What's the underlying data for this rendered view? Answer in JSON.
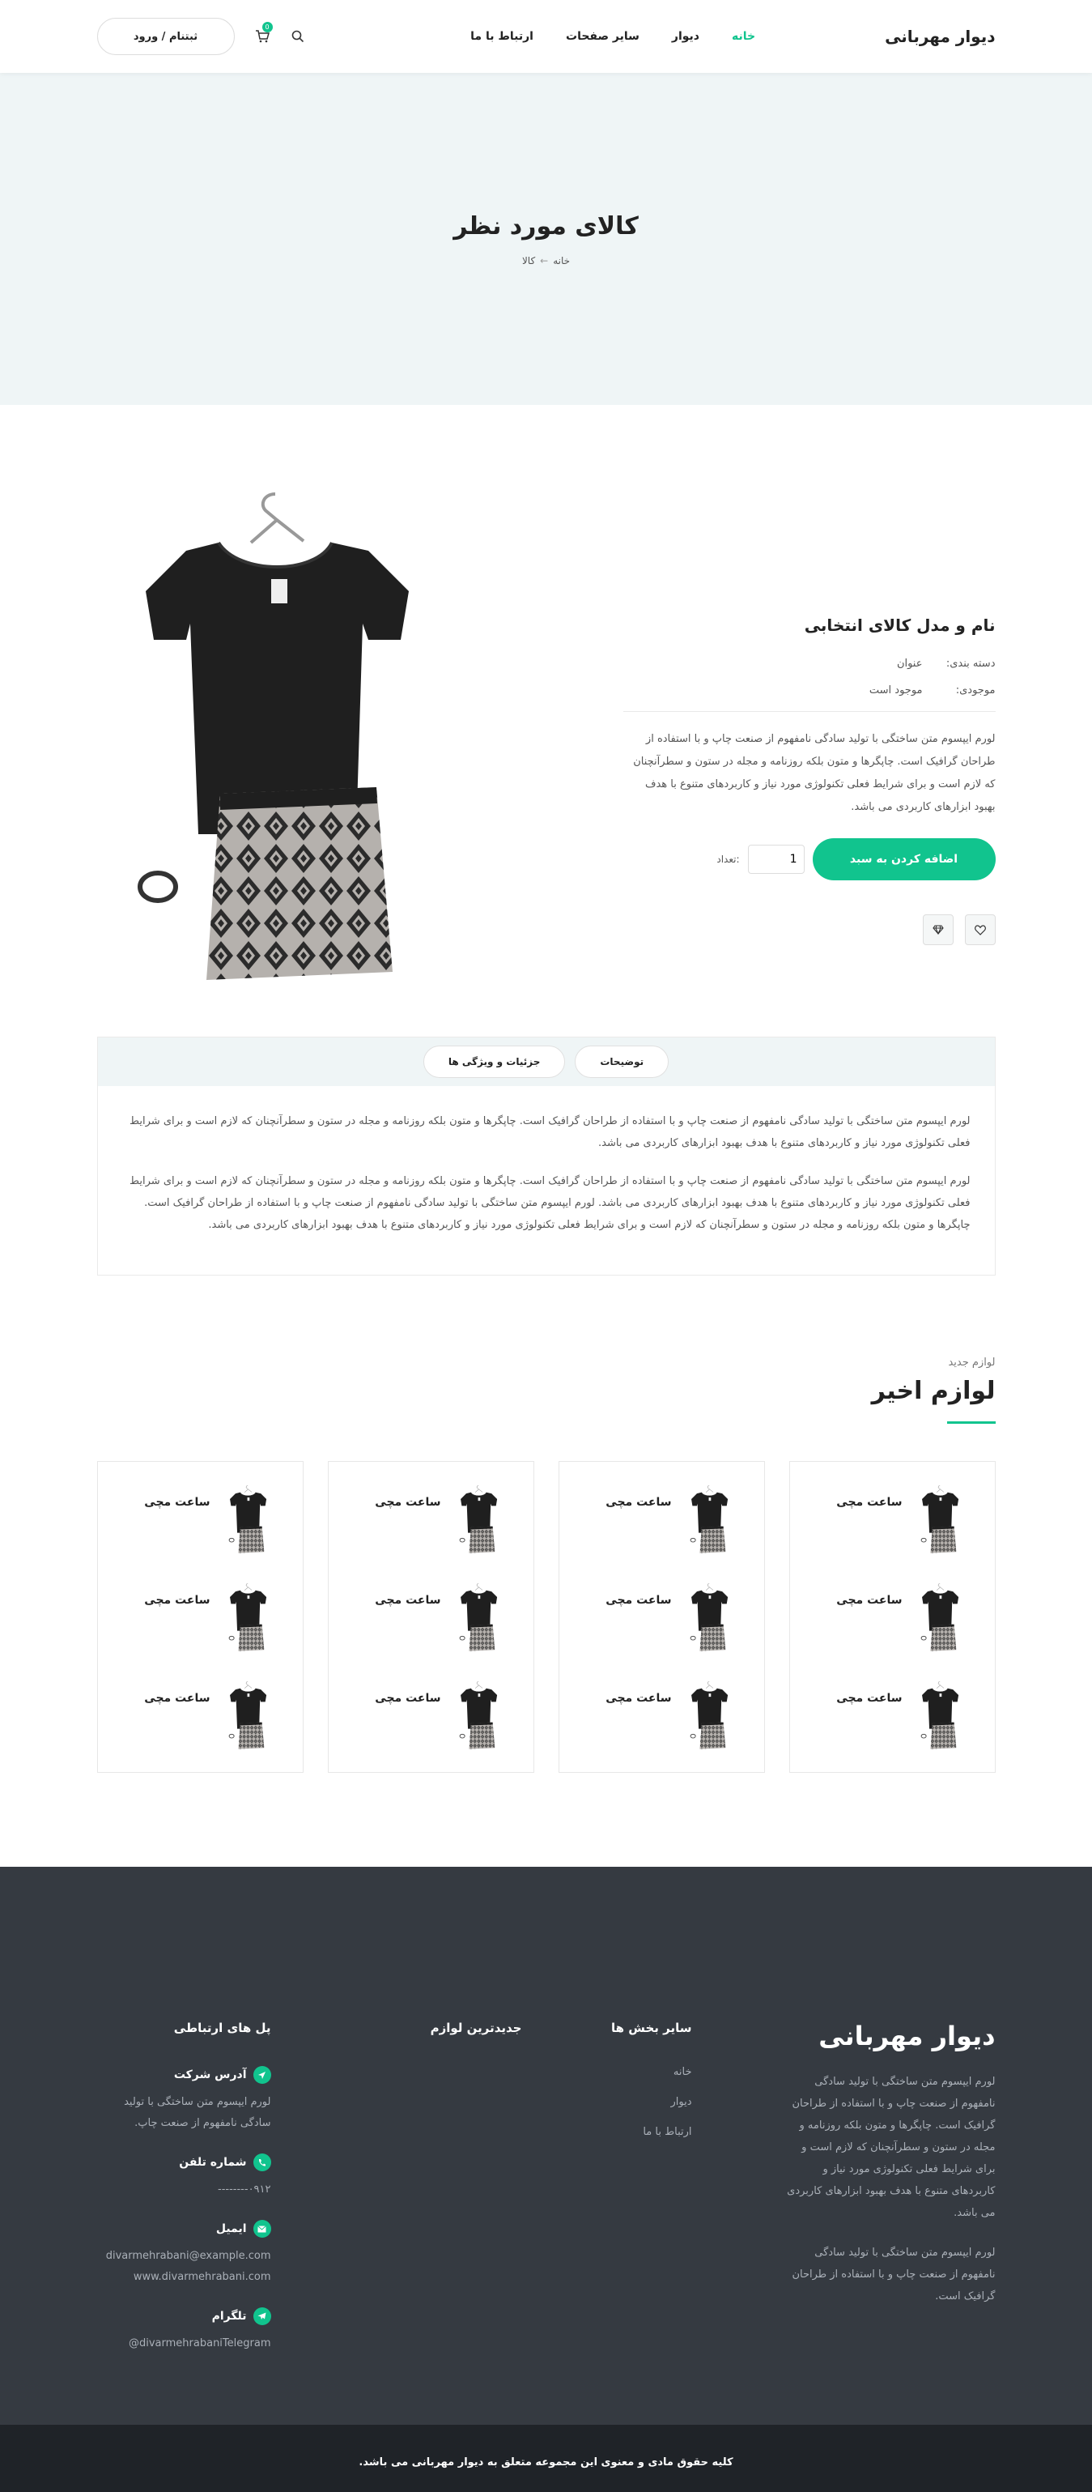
{
  "header": {
    "logo": "دیوار مهربانی",
    "nav": [
      {
        "label": "خانه",
        "active": true
      },
      {
        "label": "دیوار",
        "active": false
      },
      {
        "label": "سایر صفحات",
        "active": false
      },
      {
        "label": "ارتباط با ما",
        "active": false
      }
    ],
    "cart_count": "0",
    "login_label": "ثبتنام / ورود"
  },
  "hero": {
    "title": "کالای مورد نظر",
    "breadcrumb": [
      "خانه",
      "کالا"
    ]
  },
  "product": {
    "name": "نام و مدل کالای انتخابی",
    "category_label": "دسته بندی:",
    "category_value": "عنوان",
    "stock_label": "موجودی:",
    "stock_value": "موجود است",
    "description": "لورم ایپسوم متن ساختگی با تولید سادگی نامفهوم از صنعت چاپ و با استفاده از طراحان گرافیک است. چاپگرها و متون بلکه روزنامه و مجله در ستون و سطرآنچنان که لازم است و برای شرایط فعلی تکنولوژی مورد نیاز و کاربردهای متنوع با هدف بهبود ابزارهای کاربردی می باشد.",
    "add_to_cart": "اضافه کردن به سبد",
    "qty_label": ":تعداد",
    "qty_value": "1"
  },
  "tabs": {
    "items": [
      "توضیحات",
      "جزئیات و ویژگی ها"
    ],
    "paragraphs": [
      "لورم ایپسوم متن ساختگی با تولید سادگی نامفهوم از صنعت چاپ و با استفاده از طراحان گرافیک است. چاپگرها و متون بلکه روزنامه و مجله در ستون و سطرآنچنان که لازم است و برای شرایط فعلی تکنولوژی مورد نیاز و کاربردهای متنوع با هدف بهبود ابزارهای کاربردی می باشد.",
      "لورم ایپسوم متن ساختگی با تولید سادگی نامفهوم از صنعت چاپ و با استفاده از طراحان گرافیک است. چاپگرها و متون بلکه روزنامه و مجله در ستون و سطرآنچنان که لازم است و برای شرایط فعلی تکنولوژی مورد نیاز و کاربردهای متنوع با هدف بهبود ابزارهای کاربردی می باشد. لورم ایپسوم متن ساختگی با تولید سادگی نامفهوم از صنعت چاپ و با استفاده از طراحان گرافیک است. چاپگرها و متون بلکه روزنامه و مجله در ستون و سطرآنچنان که لازم است و برای شرایط فعلی تکنولوژی مورد نیاز و کاربردهای متنوع با هدف بهبود ابزارهای کاربردی می باشد."
    ]
  },
  "recent": {
    "subtitle": "لوازم جدید",
    "title": "لوازم اخیر",
    "item_name": "ساعت مچی"
  },
  "footer": {
    "brand": "دیوار مهربانی",
    "about_1": "لورم ایپسوم متن ساختگی با تولید سادگی نامفهوم از صنعت چاپ و با استفاده از طراحان گرافیک است. چاپگرها و متون بلکه روزنامه و مجله در ستون و سطرآنچنان که لازم است و برای شرایط فعلی تکنولوژی مورد نیاز و کاربردهای متنوع با هدف بهبود ابزارهای کاربردی می باشد.",
    "about_2": "لورم ایپسوم متن ساختگی با تولید سادگی نامفهوم از صنعت چاپ و با استفاده از طراحان گرافیک است.",
    "sections_title": "سایر بخش ها",
    "sections": [
      "خانه",
      "دیوار",
      "ارتباط با ما"
    ],
    "latest_title": "جدیدترین لوازم",
    "contact_title": "پل های ارتباطی",
    "address_label": "آدرس شرکت",
    "address_text": "لورم ایپسوم متن ساختگی با تولید سادگی نامفهوم از صنعت چاپ.",
    "phone_label": "شماره تلفن",
    "phone_text": "۰۹۱۲--------",
    "email_label": "ایمیل",
    "email_1": "divarmehrabani@example.com",
    "email_2": "www.divarmehrabani.com",
    "telegram_label": "تلگرام",
    "telegram_text": "divarmehrabaniTelegram@",
    "copyright": "کلیه حقوق مادی و معنوی این مجموعه متعلق به دیوار مهربانی می باشد."
  },
  "colors": {
    "accent": "#11c48e",
    "hero_bg": "#eff5f6",
    "footer_bg": "#353a41",
    "copyright_bg": "#1f2328"
  }
}
